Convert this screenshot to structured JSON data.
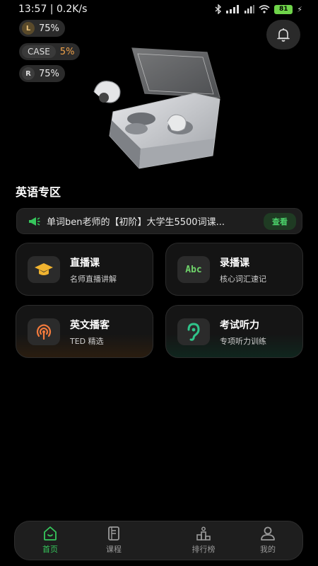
{
  "status_bar": {
    "time": "13:57 | 0.2K/s",
    "battery": "81"
  },
  "device": {
    "left": {
      "badge": "L",
      "value": "75%"
    },
    "case": {
      "label": "CASE",
      "value": "5%"
    },
    "right": {
      "badge": "R",
      "value": "75%"
    }
  },
  "section": {
    "title": "英语专区"
  },
  "notice": {
    "text": "单词ben老师的【初阶】大学生5500词课...",
    "button": "查看"
  },
  "cards": [
    {
      "title": "直播课",
      "subtitle": "名师直播讲解",
      "icon": "graduation-cap-icon"
    },
    {
      "title": "录播课",
      "subtitle": "核心词汇速记",
      "icon": "abc-icon",
      "icon_text": "Abc"
    },
    {
      "title": "英文播客",
      "subtitle": "TED 精选",
      "icon": "podcast-icon"
    },
    {
      "title": "考试听力",
      "subtitle": "专项听力训练",
      "icon": "ear-icon"
    }
  ],
  "nav": [
    {
      "label": "首页",
      "active": true
    },
    {
      "label": "课程",
      "active": false
    },
    {
      "label": "排行榜",
      "active": false
    },
    {
      "label": "我的",
      "active": false
    }
  ],
  "colors": {
    "accent_green": "#36c75c",
    "accent_orange": "#f0a24a",
    "background": "#000000"
  }
}
